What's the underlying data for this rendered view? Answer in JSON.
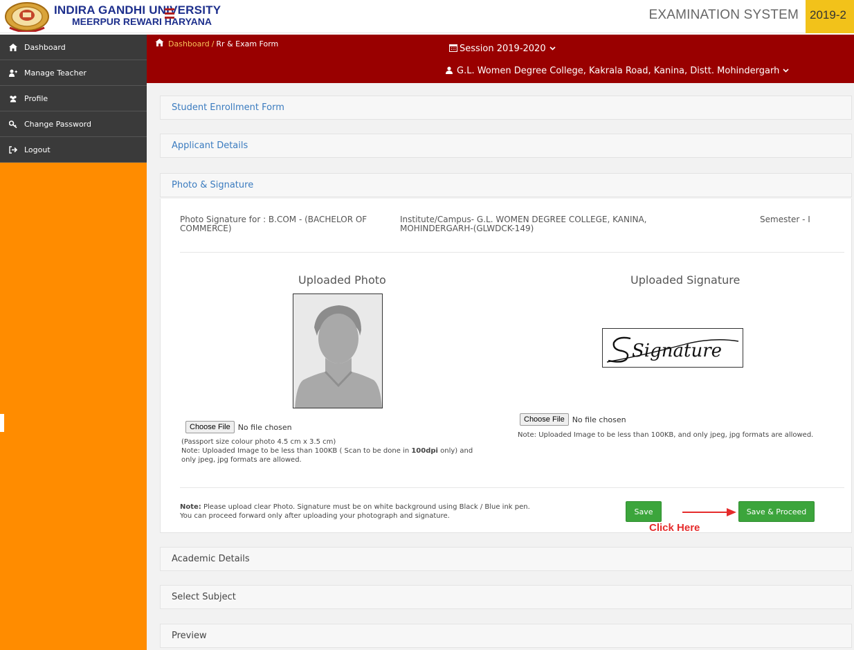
{
  "header": {
    "university_line1": "INDIRA GANDHI UNIVERSITY",
    "university_line2": "MEERPUR REWARI HARYANA",
    "system_title": "EXAMINATION SYSTEM",
    "year_badge": "2019-2"
  },
  "sidebar": {
    "items": [
      {
        "label": "Dashboard",
        "icon": "home-icon"
      },
      {
        "label": "Manage Teacher",
        "icon": "add-user-icon"
      },
      {
        "label": "Profile",
        "icon": "users-icon"
      },
      {
        "label": "Change Password",
        "icon": "key-icon"
      },
      {
        "label": "Logout",
        "icon": "logout-icon"
      }
    ]
  },
  "topbar": {
    "breadcrumb_home": "Dashboard",
    "breadcrumb_separator": "/",
    "breadcrumb_current": "Rr & Exam Form",
    "session_label": "Session  2019-2020",
    "college_label": "G.L. Women Degree College, Kakrala Road, Kanina, Distt. Mohindergarh"
  },
  "panels": {
    "student_enrollment": "Student Enrollment Form",
    "applicant_details": "Applicant Details",
    "photo_signature": "Photo & Signature",
    "academic_details": "Academic Details",
    "select_subject": "Select Subject",
    "preview": "Preview"
  },
  "photo_section": {
    "course_line1": "Photo Signature for : B.COM - (BACHELOR OF",
    "course_line2": "COMMERCE)",
    "institute_line1": "Institute/Campus- G.L. WOMEN DEGREE COLLEGE, KANINA,",
    "institute_line2": "MOHINDERGARH-(GLWDCK-149)",
    "semester": "Semester - I",
    "uploaded_photo_title": "Uploaded Photo",
    "uploaded_signature_title": "Uploaded Signature",
    "signature_text": "Signature",
    "choose_file_label": "Choose File",
    "no_file_text": "No file chosen",
    "photo_note_line1": "(Passport size colour photo 4.5 cm x 3.5 cm)",
    "photo_note_line2_a": "Note: Uploaded Image to be less than 100KB ( Scan to be done in ",
    "photo_note_line2_b": "100dpi",
    "photo_note_line2_c": " only) and",
    "photo_note_line3": "only jpeg, jpg formats are allowed.",
    "signature_note": "Note: Uploaded Image to be less than 100KB, and only jpeg, jpg formats are allowed.",
    "bottom_note_bold": "Note:",
    "bottom_note_line1": " Please upload clear Photo. Signature must be on white background using Black / Blue ink pen.",
    "bottom_note_line2": "You can proceed forward only after uploading your photograph and signature.",
    "save_label": "Save",
    "save_proceed_label": "Save & Proceed",
    "click_here_label": "Click Here"
  },
  "colors": {
    "header_red": "#990000",
    "sidebar_orange": "#ff8c00",
    "nav_dark": "#3a3a3a",
    "badge_yellow": "#f2c21a",
    "button_green": "#3ca53c",
    "annotation_red": "#e52b2b",
    "panel_title_blue": "#3a7bbf"
  }
}
